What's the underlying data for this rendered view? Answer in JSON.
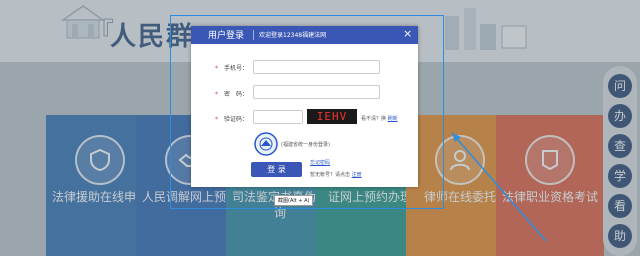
{
  "background": {
    "site_title": "人民群",
    "bracket_left": "『",
    "side_nav": [
      "问",
      "办",
      "查",
      "学",
      "看",
      "助"
    ],
    "tiles": [
      {
        "label": "法律援助在线申请",
        "color": "#2f6fb4",
        "icon": "shield-icon"
      },
      {
        "label": "人民调解网上预约",
        "color": "#2a64b2",
        "icon": "handshake-icon"
      },
      {
        "label": "司法鉴定书真伪查询",
        "color": "#2b86a3",
        "icon": "document-search-icon"
      },
      {
        "label": "证网上预约办理",
        "color": "#209287",
        "icon": "calendar-icon"
      },
      {
        "label": "律师在线委托",
        "color": "#e78a2a",
        "icon": "lawyer-icon"
      },
      {
        "label": "法律职业资格考试",
        "color": "#dd5d42",
        "icon": "certificate-icon"
      }
    ]
  },
  "dialog": {
    "title": "用户登录",
    "subtitle": "欢迎登录12348福建法网",
    "close": "×",
    "phone_label": "手机号：",
    "password_label": "密　码：",
    "captcha_label": "验证码：",
    "captcha_text": "IEHV",
    "captcha_hint": "看不清？换",
    "captcha_refresh": "刷新",
    "unified_login": "(福建省统一身份登录)",
    "login_button": "登 录",
    "forgot_password": "忘记密码",
    "no_account": "暂无帐号？请点击",
    "register": "注册"
  },
  "tooltip": "截图(Alt + A)",
  "colors": {
    "dialog_header": "#3a57b6",
    "selection": "#2f8de0"
  }
}
